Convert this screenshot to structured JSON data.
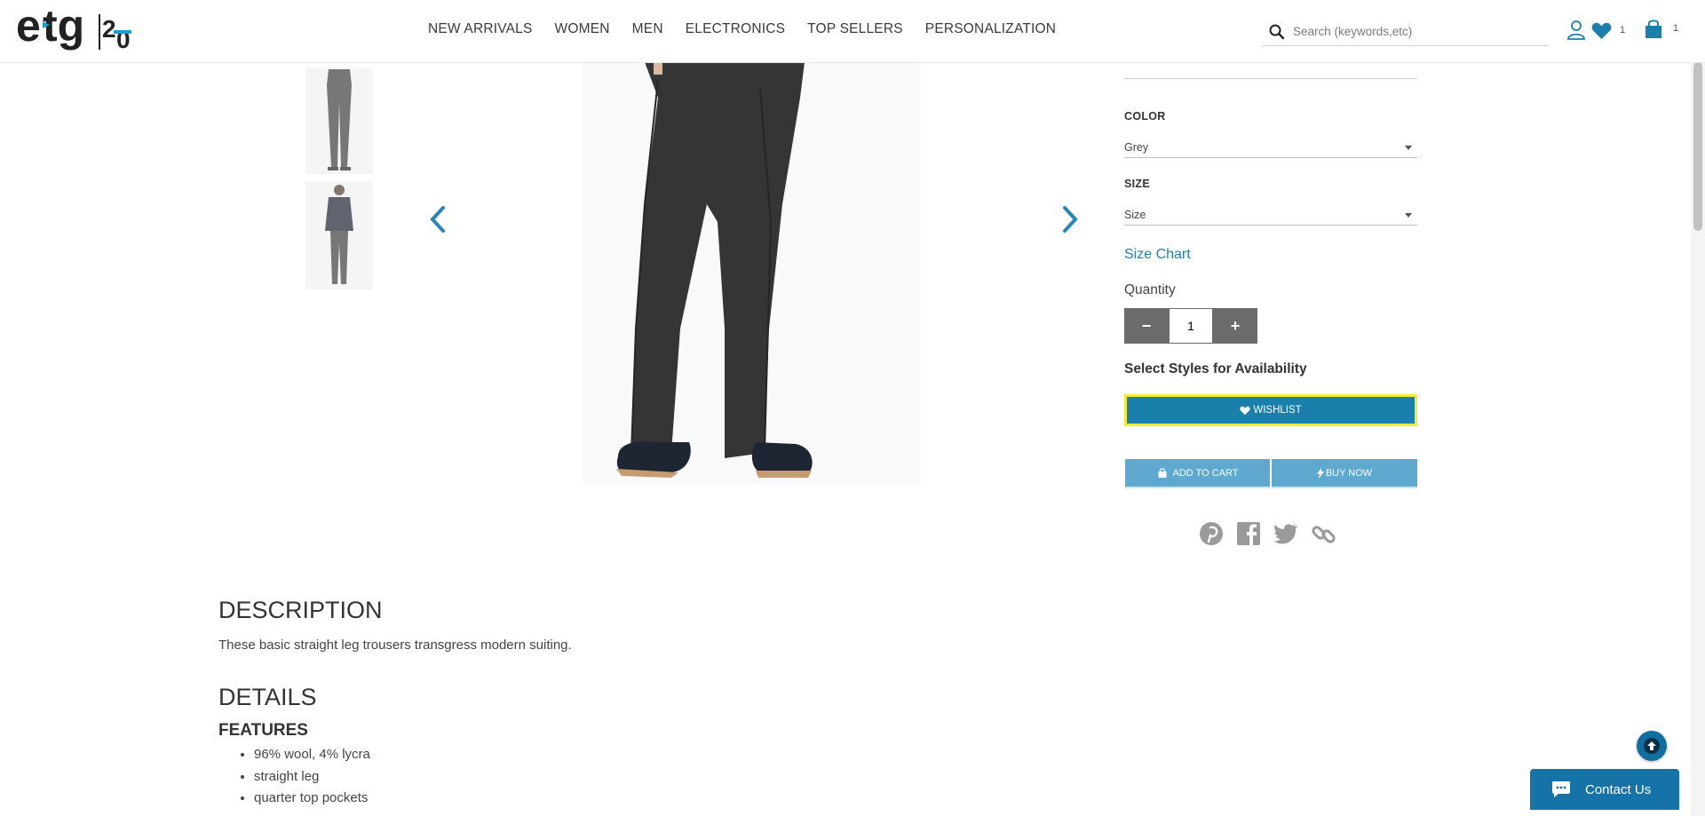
{
  "brand": {
    "logo_text": "etg",
    "logo_sub": "20"
  },
  "nav": {
    "items": [
      "NEW ARRIVALS",
      "WOMEN",
      "MEN",
      "ELECTRONICS",
      "TOP SELLERS",
      "PERSONALIZATION"
    ]
  },
  "search": {
    "placeholder": "Search (keywords,etc)"
  },
  "header_icons": {
    "wishlist_count": "1",
    "cart_count": "1"
  },
  "product": {
    "color_label": "COLOR",
    "color_value": "Grey",
    "size_label": "SIZE",
    "size_value": "Size",
    "size_chart": "Size Chart",
    "quantity_label": "Quantity",
    "quantity_value": "1",
    "qty_minus": "−",
    "qty_plus": "+",
    "availability": "Select Styles for Availability",
    "wishlist_btn": "WISHLIST",
    "add_to_cart_btn": "ADD TO CART",
    "buy_now_btn": "BUY NOW"
  },
  "description": {
    "heading": "DESCRIPTION",
    "text": "These basic straight leg trousers transgress modern suiting."
  },
  "details": {
    "heading": "DETAILS",
    "features_heading": "FEATURES",
    "features": [
      "96% wool, 4% lycra",
      "straight leg",
      "quarter top pockets"
    ]
  },
  "contact": {
    "label": "Contact Us"
  },
  "colors": {
    "accent": "#1a7fab",
    "light_button": "#5fa8cf",
    "focus_outline": "#f2ee2b",
    "qty_button": "#6b6b6b"
  }
}
